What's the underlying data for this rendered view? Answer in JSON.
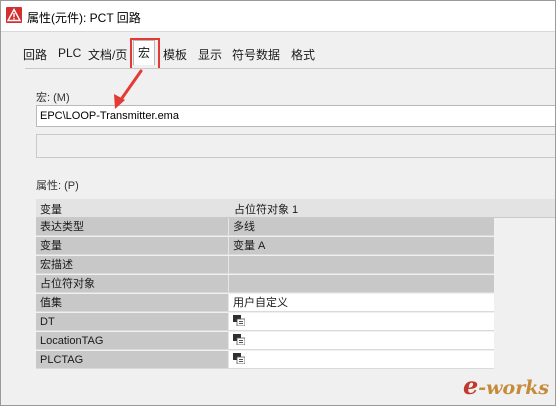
{
  "window": {
    "title": "属性(元件): PCT 回路"
  },
  "tabs": [
    {
      "label": "回路"
    },
    {
      "label": "PLC"
    },
    {
      "label": "文档/页"
    },
    {
      "label": "宏"
    },
    {
      "label": "模板"
    },
    {
      "label": "显示"
    },
    {
      "label": "符号数据"
    },
    {
      "label": "格式"
    }
  ],
  "macro": {
    "label": "宏: (M)",
    "value": "EPC\\LOOP-Transmitter.ema"
  },
  "properties": {
    "label": "属性: (P)",
    "columns": [
      "变量",
      "占位符对象 1"
    ],
    "rows": [
      {
        "name": "表达类型",
        "value": "多线",
        "style": "gray"
      },
      {
        "name": "变量",
        "value": "变量 A",
        "style": "gray"
      },
      {
        "name": "宏描述",
        "value": "",
        "style": "gray"
      },
      {
        "name": "占位符对象",
        "value": "",
        "style": "gray"
      },
      {
        "name": "值集",
        "value": "用户自定义",
        "style": "white"
      },
      {
        "name": "DT",
        "value": "",
        "style": "white",
        "icon": "language-icon"
      },
      {
        "name": "LocationTAG",
        "value": "",
        "style": "white",
        "icon": "language-icon"
      },
      {
        "name": "PLCTAG",
        "value": "",
        "style": "white",
        "icon": "language-icon"
      }
    ]
  },
  "watermark": {
    "e": "e",
    "rest": "-works"
  },
  "colors": {
    "highlight": "#e53935",
    "arrow": "#e53935",
    "title_icon": "#d32f2f"
  }
}
